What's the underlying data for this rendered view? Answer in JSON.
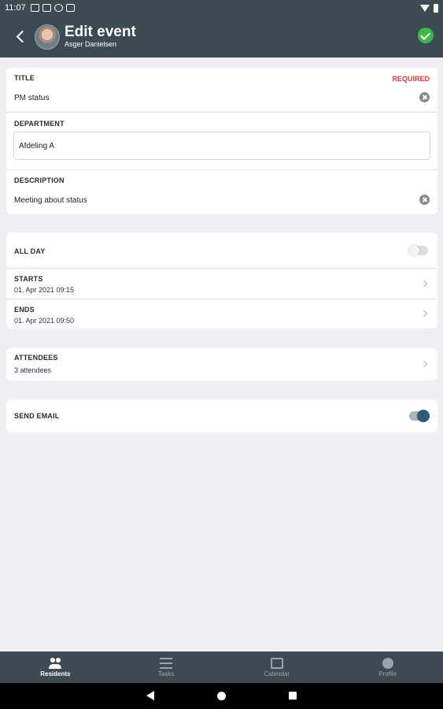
{
  "status_bar": {
    "time": "11:07"
  },
  "header": {
    "title": "Edit event",
    "subtitle": "Asger Danielsen"
  },
  "form": {
    "title": {
      "label": "TITLE",
      "required": "REQUIRED",
      "value": "PM status"
    },
    "department": {
      "label": "DEPARTMENT",
      "value": "Afdeling A"
    },
    "description": {
      "label": "DESCRIPTION",
      "value": "Meeting about status"
    },
    "all_day": {
      "label": "ALL DAY",
      "enabled": false
    },
    "starts": {
      "label": "STARTS",
      "value": "01. Apr 2021 09:15"
    },
    "ends": {
      "label": "ENDS",
      "value": "01. Apr 2021 09:50"
    },
    "attendees": {
      "label": "ATTENDEES",
      "value": "3 attendees"
    },
    "send_email": {
      "label": "SEND EMAIL",
      "enabled": true
    }
  },
  "bottom_nav": {
    "items": [
      {
        "label": "Residents",
        "icon": "people-icon",
        "active": true
      },
      {
        "label": "Tasks",
        "icon": "tasks-icon",
        "active": false
      },
      {
        "label": "Calendar",
        "icon": "calendar-icon",
        "active": false
      },
      {
        "label": "Profile",
        "icon": "profile-icon",
        "active": false
      }
    ]
  },
  "colors": {
    "bar": "#3e4a52",
    "background": "#f0eef2",
    "required": "#d33b3b",
    "confirm": "#3fb64a",
    "toggle_on": "#2f5b73"
  }
}
